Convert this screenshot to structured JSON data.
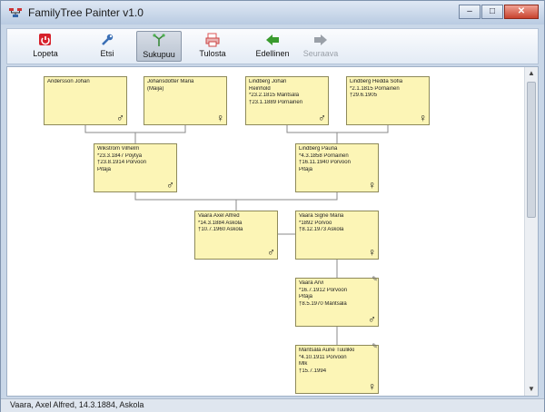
{
  "window": {
    "title": "FamilyTree Painter v1.0"
  },
  "toolbar": {
    "buttons": [
      {
        "label": "Lopeta"
      },
      {
        "label": "Etsi"
      },
      {
        "label": "Sukupuu"
      },
      {
        "label": "Tulosta"
      },
      {
        "label": "Edellinen"
      },
      {
        "label": "Seuraava"
      }
    ]
  },
  "tree": {
    "people": [
      {
        "lines": [
          "Andersson Johan"
        ],
        "gender": "male"
      },
      {
        "lines": [
          "Johansdotter Maria",
          "(Maija)"
        ],
        "gender": "female"
      },
      {
        "lines": [
          "Lindberg Johan",
          "Reinhold",
          "*23.2.1815 Mäntsälä",
          "†23.1.1889 Pornainen"
        ],
        "gender": "male"
      },
      {
        "lines": [
          "Lindberg Hedda Sofia",
          "*2.1.1815 Pornainen",
          "†29.6.1905"
        ],
        "gender": "female"
      },
      {
        "lines": [
          "Wikström Vilhelm",
          "*23.3.1847 Pöytyä",
          "†23.8.1914 Porvoon",
          "Pitäjä"
        ],
        "gender": "male"
      },
      {
        "lines": [
          "Lindberg Pauna",
          "*4.3.1858 Pornainen",
          "†16.11.1940 Porvoon",
          "Pitäjä"
        ],
        "gender": "female"
      },
      {
        "lines": [
          "Vaara Axel Alfred",
          "*14.3.1884 Askola",
          "†10.7.1960 Askola"
        ],
        "gender": "male"
      },
      {
        "lines": [
          "Vaara Signe Maria",
          "*1892 Porvoo",
          "†8.12.1973 Askola"
        ],
        "gender": "female"
      },
      {
        "lines": [
          "Vaara Arvi",
          "*16.7.1912 Porvoon",
          "Pitäjä",
          "†8.5.1970 Mäntsälä"
        ],
        "gender": "male"
      },
      {
        "lines": [
          "Mäntsälä Aune Tuulikki",
          "*4.10.1911 Porvoon",
          "Mlk",
          "†15.7.1994"
        ],
        "gender": "female"
      }
    ]
  },
  "status": {
    "text": "Vaara, Axel Alfred, 14.3.1884, Askola"
  }
}
